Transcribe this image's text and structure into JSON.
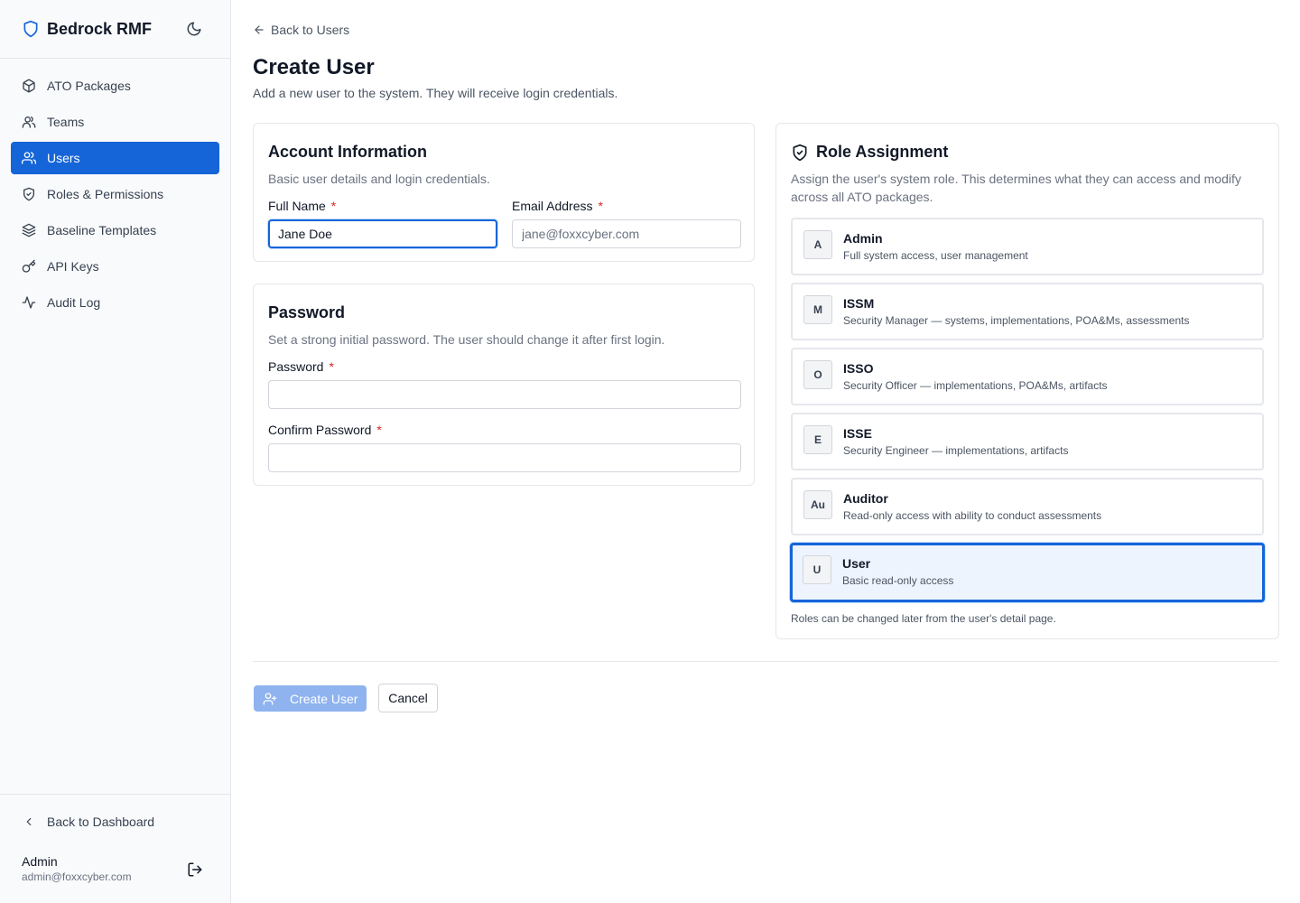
{
  "app": {
    "name": "Bedrock RMF"
  },
  "sidebar": {
    "items": [
      {
        "label": "ATO Packages",
        "icon": "package-icon",
        "active": false
      },
      {
        "label": "Teams",
        "icon": "teams-icon",
        "active": false
      },
      {
        "label": "Users",
        "icon": "users-icon",
        "active": true
      },
      {
        "label": "Roles & Permissions",
        "icon": "shield-icon",
        "active": false
      },
      {
        "label": "Baseline Templates",
        "icon": "layers-icon",
        "active": false
      },
      {
        "label": "API Keys",
        "icon": "key-icon",
        "active": false
      },
      {
        "label": "Audit Log",
        "icon": "activity-icon",
        "active": false
      }
    ],
    "back_to_dashboard": "Back to Dashboard",
    "user": {
      "name": "Admin",
      "email": "admin@foxxcyber.com"
    }
  },
  "header": {
    "back_link": "Back to Users",
    "title": "Create User",
    "subtitle": "Add a new user to the system. They will receive login credentials."
  },
  "account": {
    "title": "Account Information",
    "description": "Basic user details and login credentials.",
    "full_name_label": "Full Name",
    "full_name_value": "Jane Doe",
    "email_label": "Email Address",
    "email_placeholder": "jane@foxxcyber.com",
    "required_mark": "*"
  },
  "password": {
    "title": "Password",
    "description": "Set a strong initial password. The user should change it after first login.",
    "password_label": "Password",
    "confirm_label": "Confirm Password",
    "required_mark": "*"
  },
  "roles": {
    "title": "Role Assignment",
    "description": "Assign the user's system role. This determines what they can access and modify across all ATO packages.",
    "options": [
      {
        "badge": "A",
        "name": "Admin",
        "description": "Full system access, user management",
        "selected": false
      },
      {
        "badge": "M",
        "name": "ISSM",
        "description": "Security Manager — systems, implementations, POA&Ms, assessments",
        "selected": false
      },
      {
        "badge": "O",
        "name": "ISSO",
        "description": "Security Officer — implementations, POA&Ms, artifacts",
        "selected": false
      },
      {
        "badge": "E",
        "name": "ISSE",
        "description": "Security Engineer — implementations, artifacts",
        "selected": false
      },
      {
        "badge": "Au",
        "name": "Auditor",
        "description": "Read-only access with ability to conduct assessments",
        "selected": false
      },
      {
        "badge": "U",
        "name": "User",
        "description": "Basic read-only access",
        "selected": true
      }
    ],
    "footnote": "Roles can be changed later from the user's detail page."
  },
  "actions": {
    "create_label": "Create User",
    "cancel_label": "Cancel"
  },
  "colors": {
    "accent": "#1565d8",
    "required": "#dc2626",
    "primary_disabled": "#8fb3ef"
  }
}
